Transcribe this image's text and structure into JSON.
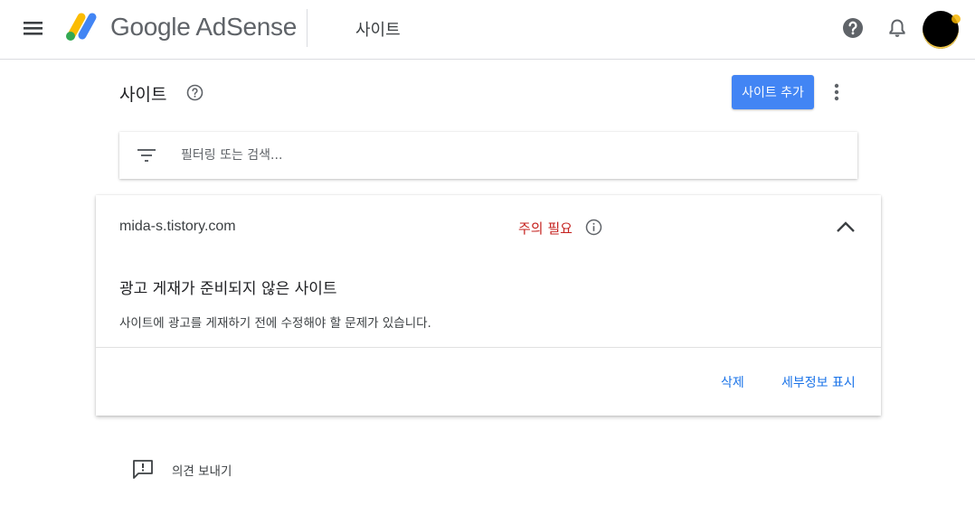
{
  "header": {
    "logo_text": "Google AdSense",
    "page_title": "사이트",
    "icons": {
      "menu": "menu-icon",
      "help": "help-circle-icon",
      "notifications": "bell-icon",
      "avatar": "avatar"
    }
  },
  "section": {
    "title": "사이트",
    "add_button": "사이트 추가",
    "help_icon": "help-outline-icon",
    "more_icon": "more-vertical-icon"
  },
  "filter": {
    "placeholder": "필터링 또는 검색...",
    "icon": "filter-icon"
  },
  "site_card": {
    "domain": "mida-s.tistory.com",
    "status": "주의 필요",
    "heading": "광고 게재가 준비되지 않은 사이트",
    "description": "사이트에 광고를 게재하기 전에 수정해야 할 문제가 있습니다.",
    "actions": {
      "delete": "삭제",
      "details": "세부정보 표시"
    }
  },
  "feedback": {
    "label": "의견 보내기",
    "icon": "feedback-icon"
  },
  "colors": {
    "primary_button": "#4285f4",
    "link": "#1a73e8",
    "warning": "#c5221f",
    "logo_yellow": "#fbbc04",
    "logo_blue": "#4285f4",
    "logo_green": "#34a853"
  }
}
